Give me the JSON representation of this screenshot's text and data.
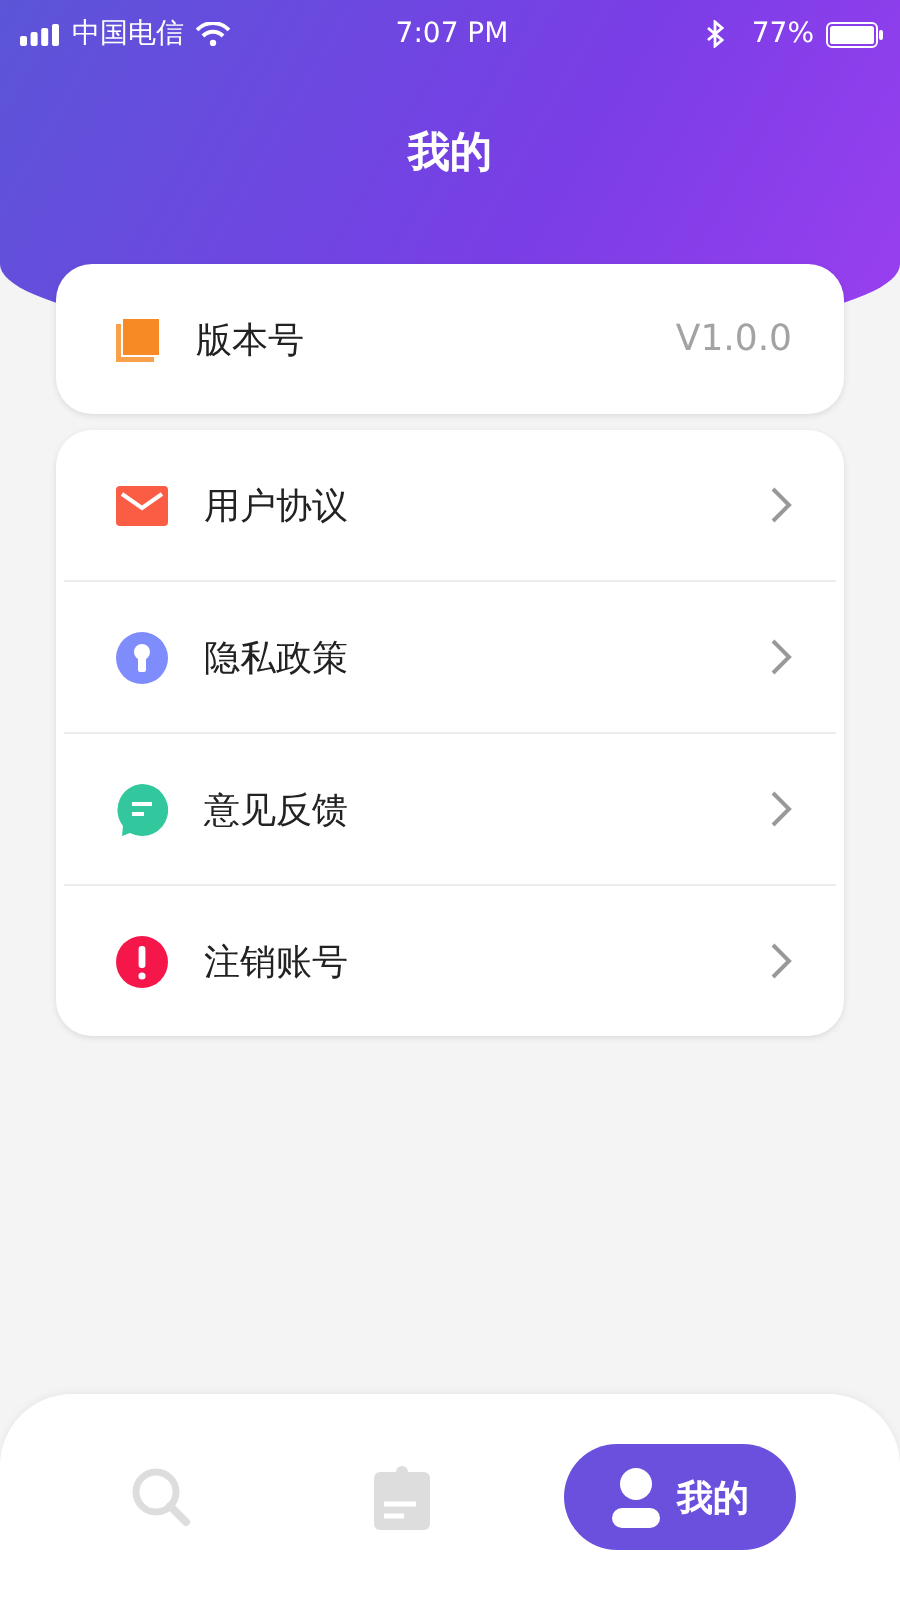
{
  "status_bar": {
    "carrier": "中国电信",
    "time": "7:07 PM",
    "battery": "77%"
  },
  "title": "我的",
  "version": {
    "label": "版本号",
    "value": "V1.0.0"
  },
  "menu": [
    {
      "kind": "mail",
      "label": "用户协议"
    },
    {
      "kind": "lock",
      "label": "隐私政策"
    },
    {
      "kind": "chat",
      "label": "意见反馈"
    },
    {
      "kind": "alert",
      "label": "注销账号"
    }
  ],
  "tabs": [
    {
      "kind": "search",
      "selected": false
    },
    {
      "kind": "clipboard",
      "selected": false
    },
    {
      "kind": "profile",
      "selected": true,
      "label": "我的"
    }
  ]
}
